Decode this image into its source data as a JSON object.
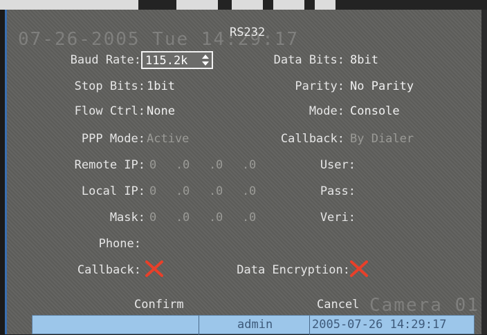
{
  "osd": {
    "datetime_watermark": "07-26-2005 Tue 14:29:17",
    "camera_watermark": "Camera 01"
  },
  "dialog": {
    "title": "RS232",
    "baud_rate": {
      "label": "Baud Rate:",
      "value": "115.2k"
    },
    "data_bits": {
      "label": "Data Bits:",
      "value": "8bit"
    },
    "stop_bits": {
      "label": "Stop Bits:",
      "value": "1bit"
    },
    "parity": {
      "label": "Parity:",
      "value": "No Parity"
    },
    "flow_ctrl": {
      "label": "Flow Ctrl:",
      "value": "None"
    },
    "mode": {
      "label": "Mode:",
      "value": "Console"
    },
    "ppp_mode": {
      "label": "PPP Mode:",
      "value": "Active"
    },
    "callback_type": {
      "label": "Callback:",
      "value": "By Dialer"
    },
    "remote_ip": {
      "label": "Remote IP:",
      "octets": [
        "0",
        "0",
        "0",
        "0"
      ]
    },
    "local_ip": {
      "label": "Local IP:",
      "octets": [
        "0",
        "0",
        "0",
        "0"
      ]
    },
    "mask": {
      "label": "Mask:",
      "octets": [
        "0",
        "0",
        "0",
        "0"
      ]
    },
    "separators": [
      ".",
      ".",
      "."
    ],
    "user": {
      "label": "User:"
    },
    "pass": {
      "label": "Pass:"
    },
    "veri": {
      "label": "Veri:"
    },
    "phone": {
      "label": "Phone:"
    },
    "callback_check": {
      "label": "Callback:",
      "checked": false
    },
    "data_encryption": {
      "label": "Data Encryption:",
      "checked": false
    },
    "confirm_label": "Confirm",
    "cancel_label": "Cancel"
  },
  "status_bar": {
    "user": "admin",
    "datetime": "2005-07-26 14:29:17"
  },
  "colors": {
    "background": "#5f5f5c",
    "text": "#e6e6e6",
    "disabled_text": "#9a9a96",
    "x_mark": "#e8402a",
    "status_bar": "#9cc6ea"
  },
  "icons": {
    "spinner": "up-down-arrows-icon",
    "unchecked": "red-x-icon"
  }
}
